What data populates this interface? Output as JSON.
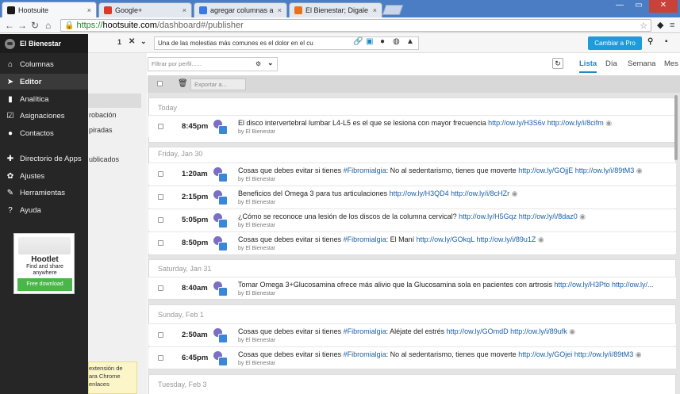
{
  "browser": {
    "tabs": [
      {
        "title": "Hootsuite",
        "color": "#1a1a1a"
      },
      {
        "title": "Google+",
        "color": "#d83a2a"
      },
      {
        "title": "agregar columnas a hoots",
        "color": "#3b78e7"
      },
      {
        "title": "El Bienestar; Digale adiós",
        "color": "#e8711a"
      }
    ],
    "tab_close": "×",
    "url_scheme": "https://",
    "url_host": "hootsuite.com",
    "url_path": "/dashboard#/publisher"
  },
  "sidebar": {
    "brand": "El Bienestar",
    "items": [
      {
        "label": "Columnas",
        "icon": "home-icon"
      },
      {
        "label": "Editor",
        "icon": "send-icon"
      },
      {
        "label": "Analítica",
        "icon": "bar-chart-icon"
      },
      {
        "label": "Asignaciones",
        "icon": "checkbox-icon"
      },
      {
        "label": "Contactos",
        "icon": "person-icon"
      },
      {
        "label": "Directorio de Apps",
        "icon": "puzzle-icon"
      },
      {
        "label": "Ajustes",
        "icon": "gear-icon"
      },
      {
        "label": "Herramientas",
        "icon": "wrench-icon"
      },
      {
        "label": "Ayuda",
        "icon": "question-icon"
      }
    ],
    "hootlet": {
      "title": "Hootlet",
      "line1": "Find and share",
      "line2": "anywhere",
      "button": "Free download"
    }
  },
  "publisher_nav": {
    "item1": "robación",
    "item2": "piradas",
    "item3": "ublicados"
  },
  "extension_note": [
    "extensión de",
    "ara Chrome",
    "enlaces"
  ],
  "composer": {
    "count": "1",
    "placeholder": "Una de las molestias más comunes es el dolor en el cu",
    "pro_button": "Cambiar a Pro"
  },
  "filter": {
    "placeholder": "Filtrar por perfil......",
    "views": [
      "Lista",
      "Día",
      "Semana",
      "Mes"
    ],
    "active_view": "Lista",
    "export": "Exportar a..."
  },
  "days": [
    {
      "header": "Today",
      "rows": [
        {
          "time": "8:45pm",
          "text": "El disco intervertebral lumbar L4-L5 es el que se lesiona con mayor frecuencia ",
          "link": "http://ow.ly/H3S6v http://ow.ly/i/8cifm",
          "by": "by El Bienestar"
        }
      ]
    },
    {
      "header": "Friday, Jan 30",
      "rows": [
        {
          "time": "1:20am",
          "text": "Cosas que debes evitar si tienes ",
          "tag": "#Fibromialgia",
          "text2": ": No al sedentarismo, tienes que moverte ",
          "link": "http://ow.ly/GOjjE http://ow.ly/i/89tM3",
          "by": "by El Bienestar"
        },
        {
          "time": "2:15pm",
          "text": "Beneficios del Omega 3 para tus articulaciones ",
          "link": "http://ow.ly/H3QD4 http://ow.ly/i/8cHZr",
          "by": "by El Bienestar"
        },
        {
          "time": "5:05pm",
          "text": "¿Cómo se reconoce una lesión de los discos de la columna cervical? ",
          "link": "http://ow.ly/H5Gqz http://ow.ly/i/8daz0",
          "by": "by El Bienestar"
        },
        {
          "time": "8:50pm",
          "text": "Cosas que debes evitar si tienes ",
          "tag": "#Fibromialgia",
          "text2": ": El Maní ",
          "link": "http://ow.ly/GOkqL http://ow.ly/i/89u1Z",
          "by": "by El Bienestar"
        }
      ]
    },
    {
      "header": "Saturday, Jan 31",
      "rows": [
        {
          "time": "8:40am",
          "text": "Tomar Omega 3+Glucosamina ofrece más alivio que la Glucosamina sola en pacientes con artrosis ",
          "link": "http://ow.ly/H3Pto http://ow.ly/...",
          "by": "by El Bienestar"
        }
      ]
    },
    {
      "header": "Sunday, Feb 1",
      "rows": [
        {
          "time": "2:50am",
          "text": "Cosas que debes evitar si tienes ",
          "tag": "#Fibromialgia",
          "text2": ": Aléjate del estrés ",
          "link": "http://ow.ly/GOmdD http://ow.ly/i/89ufk",
          "by": "by El Bienestar"
        },
        {
          "time": "6:45pm",
          "text": "Cosas que debes evitar si tienes ",
          "tag": "#Fibromialgia",
          "text2": ": No al sedentarismo, tienes que moverte ",
          "link": "http://ow.ly/GOjei http://ow.ly/i/89tM3",
          "by": "by El Bienestar"
        }
      ]
    },
    {
      "header": "Tuesday, Feb 3",
      "rows": []
    }
  ],
  "colors": {
    "link": "#1a5fa8",
    "tag": "#1a5fa8",
    "accent": "#1e9bdb"
  }
}
